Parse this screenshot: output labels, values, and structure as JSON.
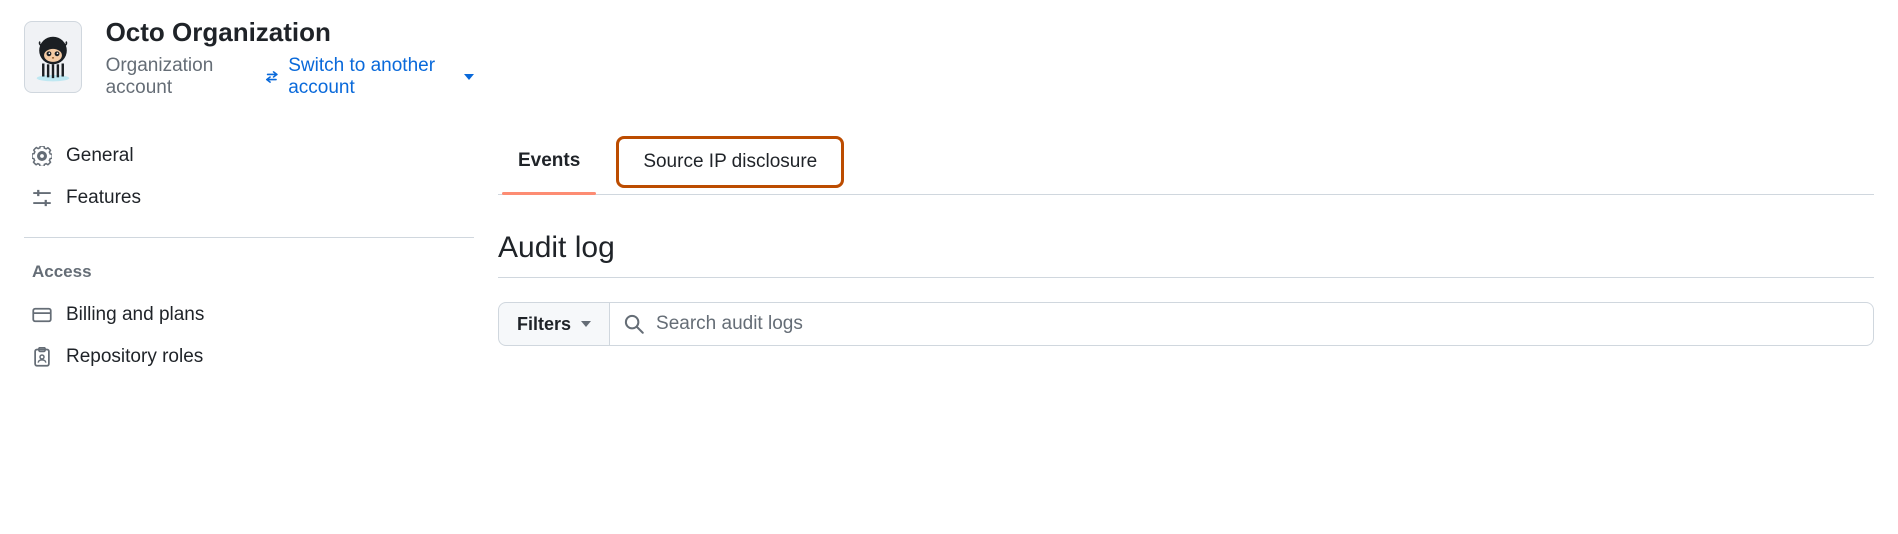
{
  "org": {
    "name": "Octo Organization",
    "subtitle": "Organization account",
    "switch_label": "Switch to another account"
  },
  "sidebar": {
    "items": [
      {
        "icon": "gear-icon",
        "label": "General"
      },
      {
        "icon": "sliders-icon",
        "label": "Features"
      }
    ],
    "section_heading": "Access",
    "access_items": [
      {
        "icon": "credit-card-icon",
        "label": "Billing and plans"
      },
      {
        "icon": "clipboard-person-icon",
        "label": "Repository roles"
      }
    ]
  },
  "main": {
    "tabs": [
      {
        "label": "Events",
        "active": true
      },
      {
        "label": "Source IP disclosure",
        "active": false,
        "highlighted": true
      }
    ],
    "heading": "Audit log",
    "filters_label": "Filters",
    "search_placeholder": "Search audit logs"
  }
}
